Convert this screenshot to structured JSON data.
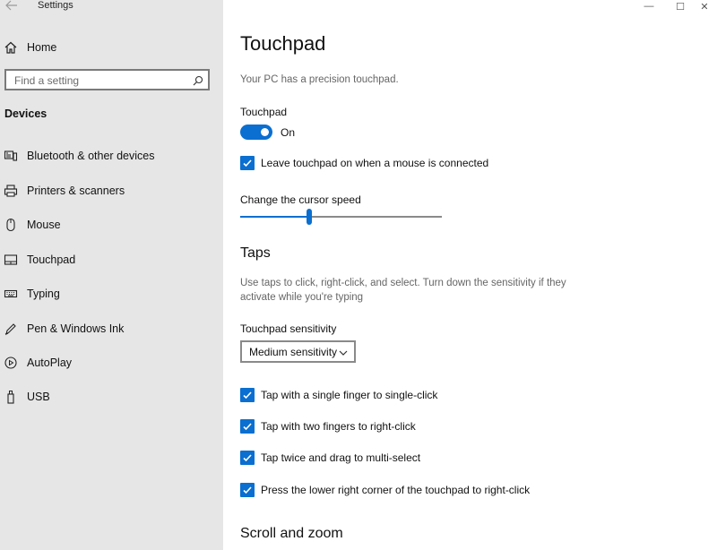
{
  "window": {
    "title": "Settings",
    "controls": {
      "minimize": "—",
      "maximize": "☐",
      "close": "✕"
    }
  },
  "sidebar": {
    "home_label": "Home",
    "search": {
      "placeholder": "Find a setting"
    },
    "section_header": "Devices",
    "items": [
      {
        "label": "Bluetooth & other devices",
        "icon": "bluetooth-devices-icon"
      },
      {
        "label": "Printers & scanners",
        "icon": "printer-icon"
      },
      {
        "label": "Mouse",
        "icon": "mouse-icon"
      },
      {
        "label": "Touchpad",
        "icon": "touchpad-icon"
      },
      {
        "label": "Typing",
        "icon": "keyboard-icon"
      },
      {
        "label": "Pen & Windows Ink",
        "icon": "pen-icon"
      },
      {
        "label": "AutoPlay",
        "icon": "autoplay-icon"
      },
      {
        "label": "USB",
        "icon": "usb-icon"
      }
    ]
  },
  "main": {
    "title": "Touchpad",
    "precision_note": "Your PC has a precision touchpad.",
    "touchpad_toggle": {
      "label": "Touchpad",
      "state": "On"
    },
    "leave_on_checkbox": "Leave touchpad on when a mouse is connected",
    "cursor_speed": {
      "label": "Change the cursor speed",
      "value_fraction": 0.34
    },
    "taps": {
      "title": "Taps",
      "description_line1": "Use taps to click, right-click, and select. Turn down the sensitivity if they",
      "description_line2": "activate while you're typing",
      "sensitivity_label": "Touchpad sensitivity",
      "sensitivity_value": "Medium sensitivity",
      "checkboxes": [
        "Tap with a single finger to single-click",
        "Tap with two fingers to right-click",
        "Tap twice and drag to multi-select",
        "Press the lower right corner of the touchpad to right-click"
      ]
    },
    "scroll_zoom_title": "Scroll and zoom"
  },
  "colors": {
    "accent": "#0a6fd0",
    "sidebar_bg": "#e6e6e6",
    "main_bg": "#ffffff"
  }
}
